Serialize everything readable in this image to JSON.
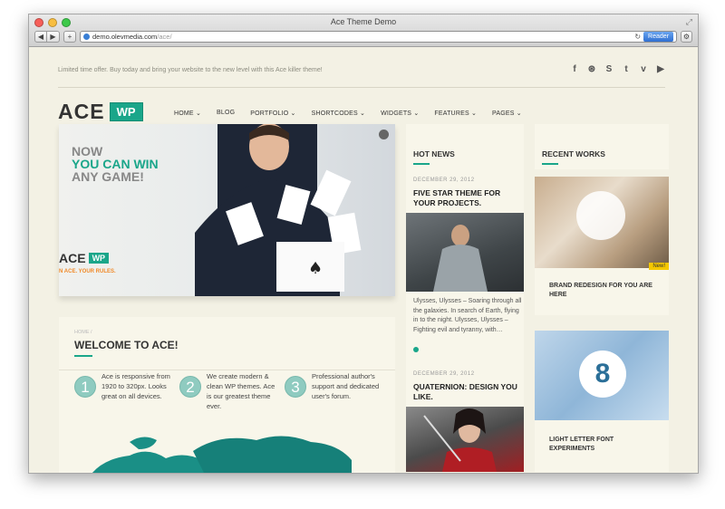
{
  "browser": {
    "window_title": "Ace Theme Demo",
    "url_domain": "demo.olevmedia.com",
    "url_path": "/ace/",
    "reader_label": "Reader"
  },
  "topbar": {
    "promo": "Limited time offer. Buy today and bring your website to the new level with this Ace killer theme!",
    "socials": [
      "facebook-icon",
      "dribbble-icon",
      "skype-icon",
      "twitter-icon",
      "vimeo-icon",
      "youtube-icon"
    ]
  },
  "logo": {
    "ace": "ACE",
    "wp": "WP"
  },
  "nav": {
    "items": [
      "HOME ⌄",
      "BLOG",
      "PORTFOLIO ⌄",
      "SHORTCODES ⌄",
      "WIDGETS ⌄",
      "FEATURES ⌄",
      "PAGES ⌄"
    ]
  },
  "hero": {
    "line1": "NOW",
    "line2": "YOU CAN WIN",
    "line3": "ANY GAME!",
    "logo_ace": "ACE",
    "logo_wp": "WP",
    "tagline": "N ACE. YOUR RULES."
  },
  "welcome": {
    "breadcrumb": "HOME /",
    "title": "WELCOME TO ACE!",
    "features": [
      {
        "num": "1",
        "text": "Ace is responsive from 1920 to 320px. Looks great on all devices."
      },
      {
        "num": "2",
        "text": "We create modern & clean WP themes. Ace is our greatest theme ever."
      },
      {
        "num": "3",
        "text": "Professional author's support and dedicated user's forum."
      }
    ]
  },
  "news": {
    "heading": "HOT NEWS",
    "items": [
      {
        "date": "DECEMBER 29, 2012",
        "title": "FIVE STAR THEME FOR YOUR PROJECTS.",
        "text": "Ulysses, Ulysses – Soaring through all the galaxies. In search of Earth, flying in to the night. Ulysses, Ulysses – Fighting evil and tyranny, with…"
      },
      {
        "date": "DECEMBER 29, 2012",
        "title": "QUATERNION: DESIGN YOU LIKE."
      }
    ]
  },
  "works": {
    "heading": "RECENT WORKS",
    "items": [
      {
        "title": "BRAND REDESIGN FOR YOU ARE HERE",
        "badge": "New!"
      },
      {
        "title": "LIGHT LETTER FONT EXPERIMENTS"
      }
    ]
  },
  "colors": {
    "accent": "#1aa68a",
    "background": "#f3f1e4",
    "card": "#f8f6ea"
  }
}
